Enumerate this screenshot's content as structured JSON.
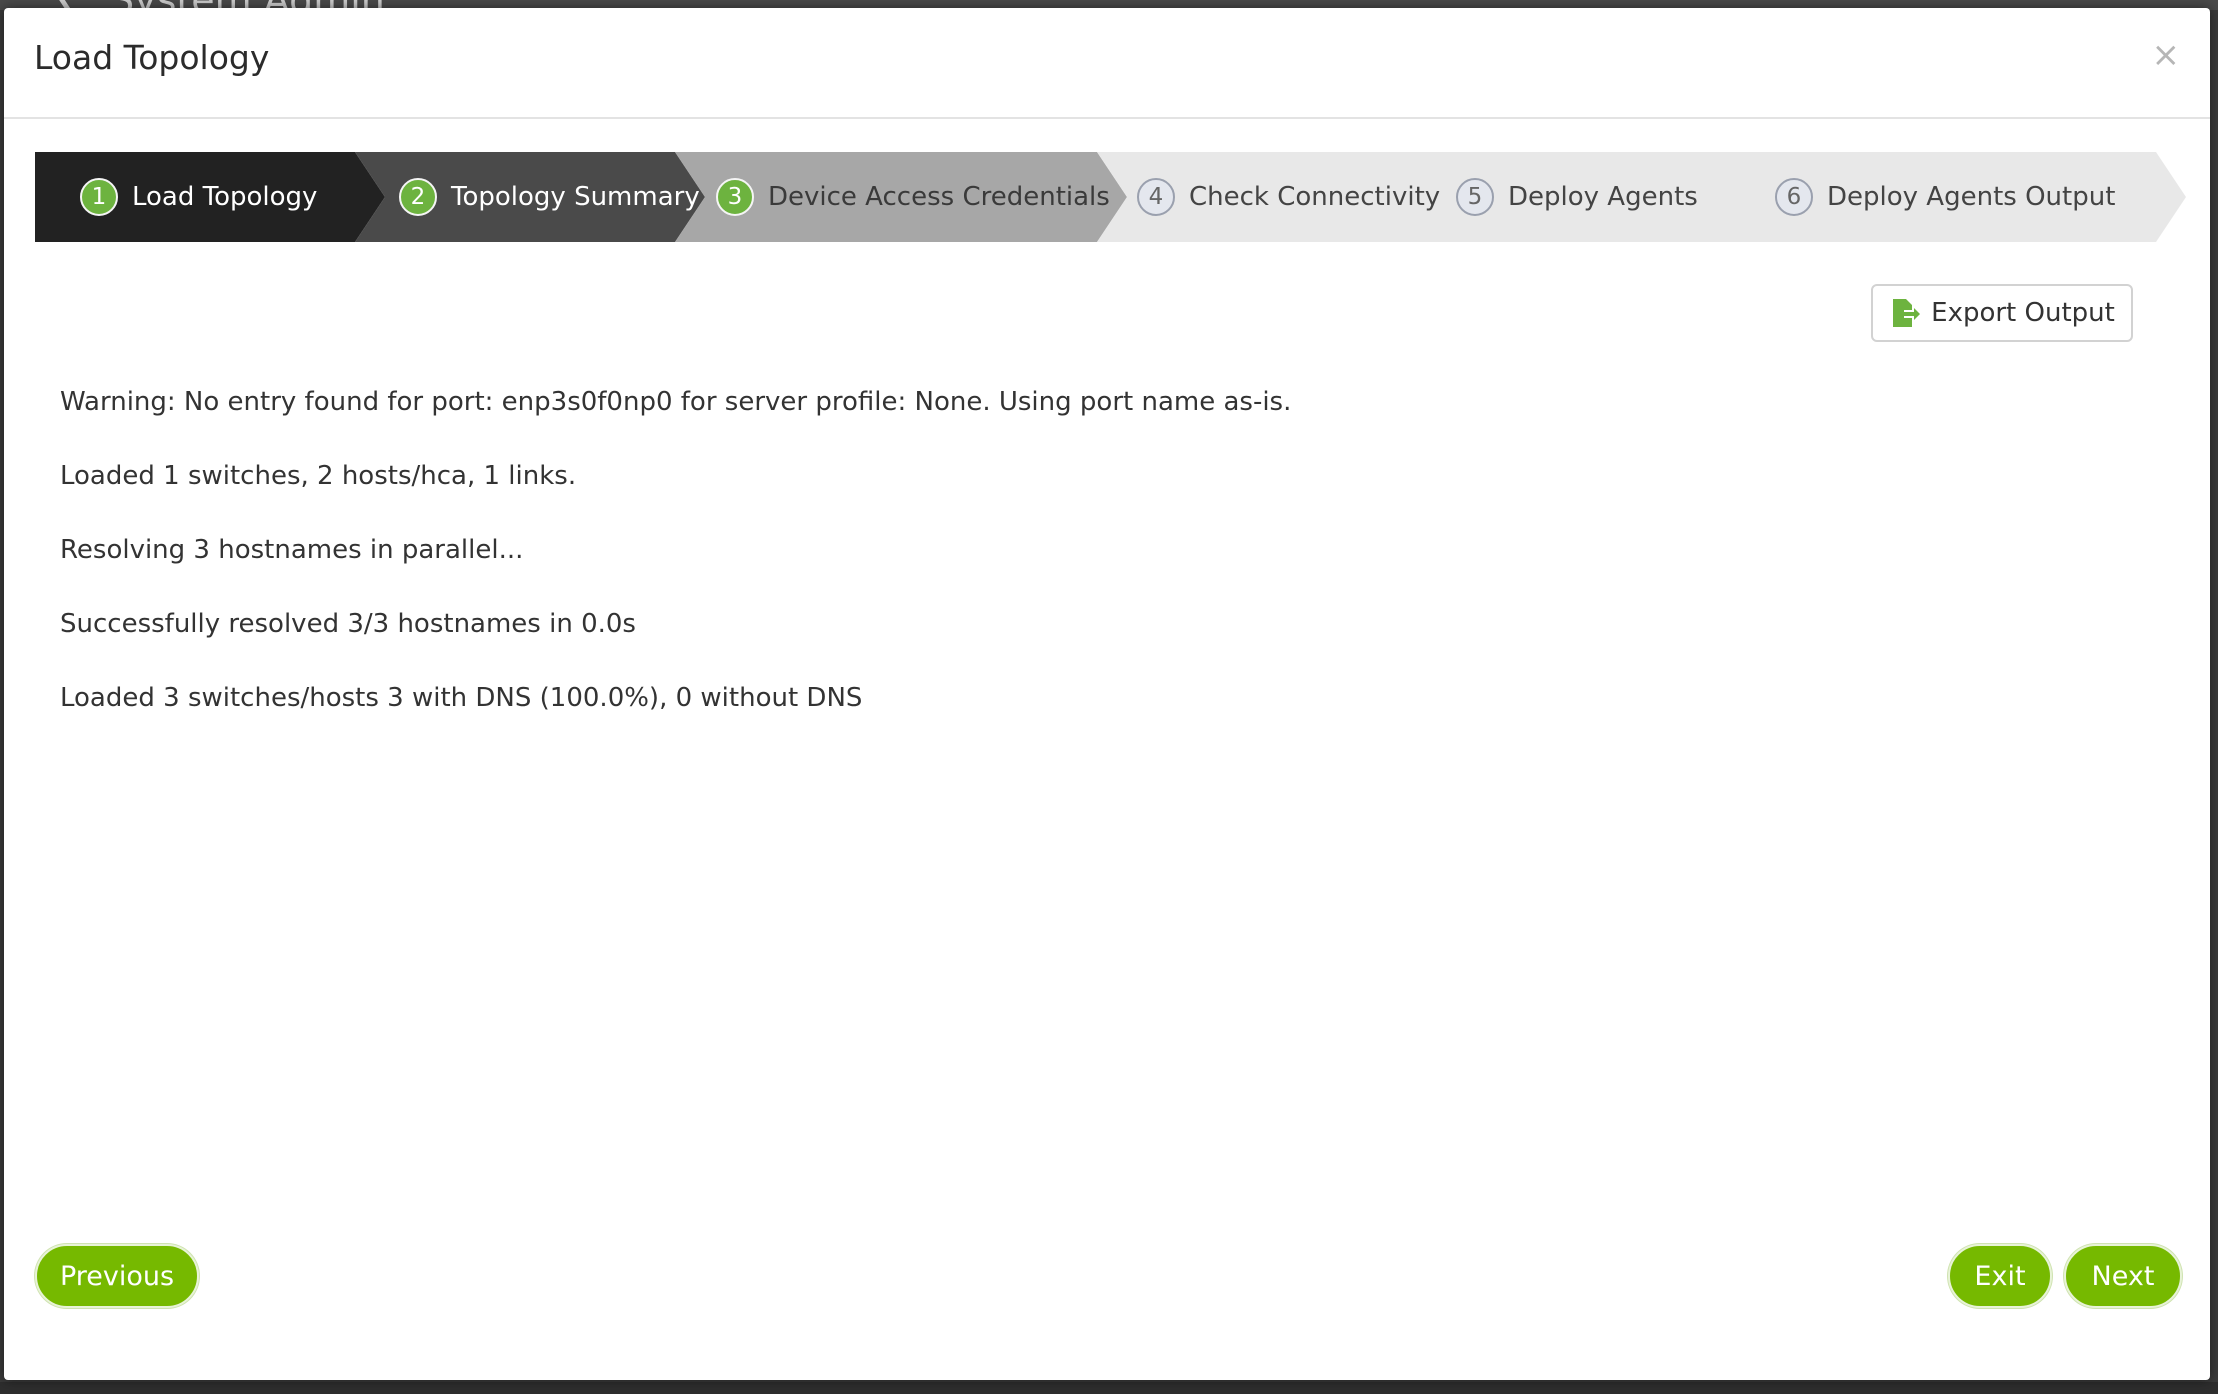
{
  "background": {
    "title": "System Admin"
  },
  "modal": {
    "title": "Load Topology",
    "close_glyph": "×"
  },
  "steps": [
    {
      "number": "1",
      "label": "Load Topology",
      "state": "completed",
      "bg_color": "#222222",
      "text_color": "#ffffff"
    },
    {
      "number": "2",
      "label": "Topology Summary",
      "state": "completed",
      "bg_color": "#4a4a4a",
      "text_color": "#ffffff"
    },
    {
      "number": "3",
      "label": "Device Access Credentials",
      "state": "current",
      "bg_color": "#a7a7a7",
      "text_color": "#3a3a3a"
    },
    {
      "number": "4",
      "label": "Check Connectivity",
      "state": "pending",
      "bg_color": "#e8e8e8",
      "text_color": "#444444"
    },
    {
      "number": "5",
      "label": "Deploy Agents",
      "state": "pending",
      "bg_color": "#e8e8e8",
      "text_color": "#444444"
    },
    {
      "number": "6",
      "label": "Deploy Agents Output",
      "state": "pending",
      "bg_color": "#e8e8e8",
      "text_color": "#444444"
    }
  ],
  "export_button": {
    "label": "Export Output",
    "icon": "file-export-icon",
    "icon_color": "#6db33f"
  },
  "output_lines": [
    "Warning: No entry found for port: enp3s0f0np0 for server profile: None. Using port name as-is.",
    "Loaded 1 switches, 2 hosts/hca, 1 links.",
    "Resolving 3 hostnames in parallel...",
    "Successfully resolved 3/3 hostnames in 0.0s",
    "Loaded 3 switches/hosts 3 with DNS (100.0%), 0 without DNS"
  ],
  "footer": {
    "previous_label": "Previous",
    "exit_label": "Exit",
    "next_label": "Next"
  },
  "colors": {
    "accent": "#76b900",
    "step_done": "#6db33f"
  }
}
